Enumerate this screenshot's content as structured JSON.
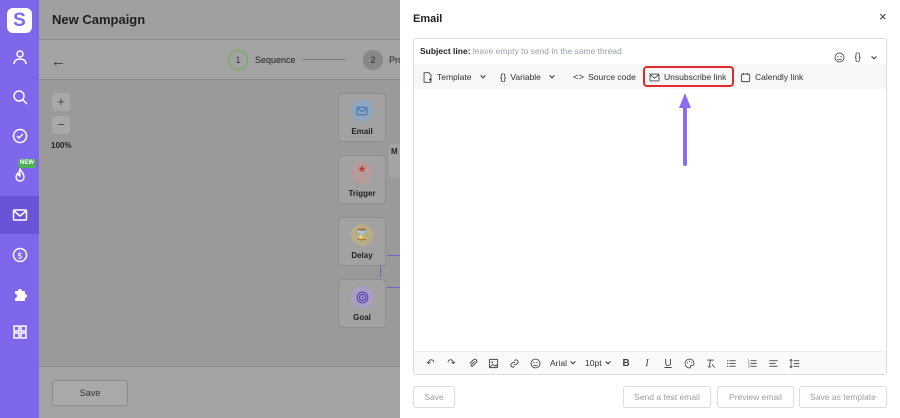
{
  "sidebar": {
    "logo": "S",
    "new_badge": "NEW",
    "items": [
      {
        "icon": "user-icon"
      },
      {
        "icon": "search-icon"
      },
      {
        "icon": "check-circle-icon"
      },
      {
        "icon": "fire-icon"
      },
      {
        "icon": "mail-icon",
        "active": true
      },
      {
        "icon": "dollar-icon"
      },
      {
        "icon": "puzzle-icon"
      },
      {
        "icon": "grid-icon"
      }
    ]
  },
  "app": {
    "title": "New Campaign",
    "steps": [
      {
        "number": "1",
        "label": "Sequence"
      },
      {
        "number": "2",
        "label": "Pro"
      }
    ],
    "zoom": {
      "plus": "+",
      "minus": "−",
      "level": "100%"
    },
    "nodes": [
      {
        "label": "Email",
        "icon": "mail-icon"
      },
      {
        "label": "Trigger",
        "icon": "asterisk-icon"
      },
      {
        "label": "Delay",
        "icon": "hourglass-icon"
      },
      {
        "label": "Goal",
        "icon": "target-icon"
      }
    ],
    "side_label": "M",
    "save_label": "Save"
  },
  "modal": {
    "title": "Email",
    "close": "×",
    "subject": {
      "label": "Subject line:",
      "placeholder": "leave empty to send in the same thread"
    },
    "toolbar": {
      "template": "Template",
      "variable": "Variable",
      "source_code": "Source code",
      "unsubscribe": "Unsubscribe link",
      "calendly": "Calendly link"
    },
    "format": {
      "font": "Arial",
      "size": "10pt"
    },
    "footer": {
      "save": "Save",
      "send_test": "Send a test email",
      "preview": "Preview email",
      "save_template": "Save as template"
    }
  },
  "colors": {
    "brand": "#7f67ec",
    "highlight": "#e32a2a",
    "arrow": "#8b6cf0"
  }
}
